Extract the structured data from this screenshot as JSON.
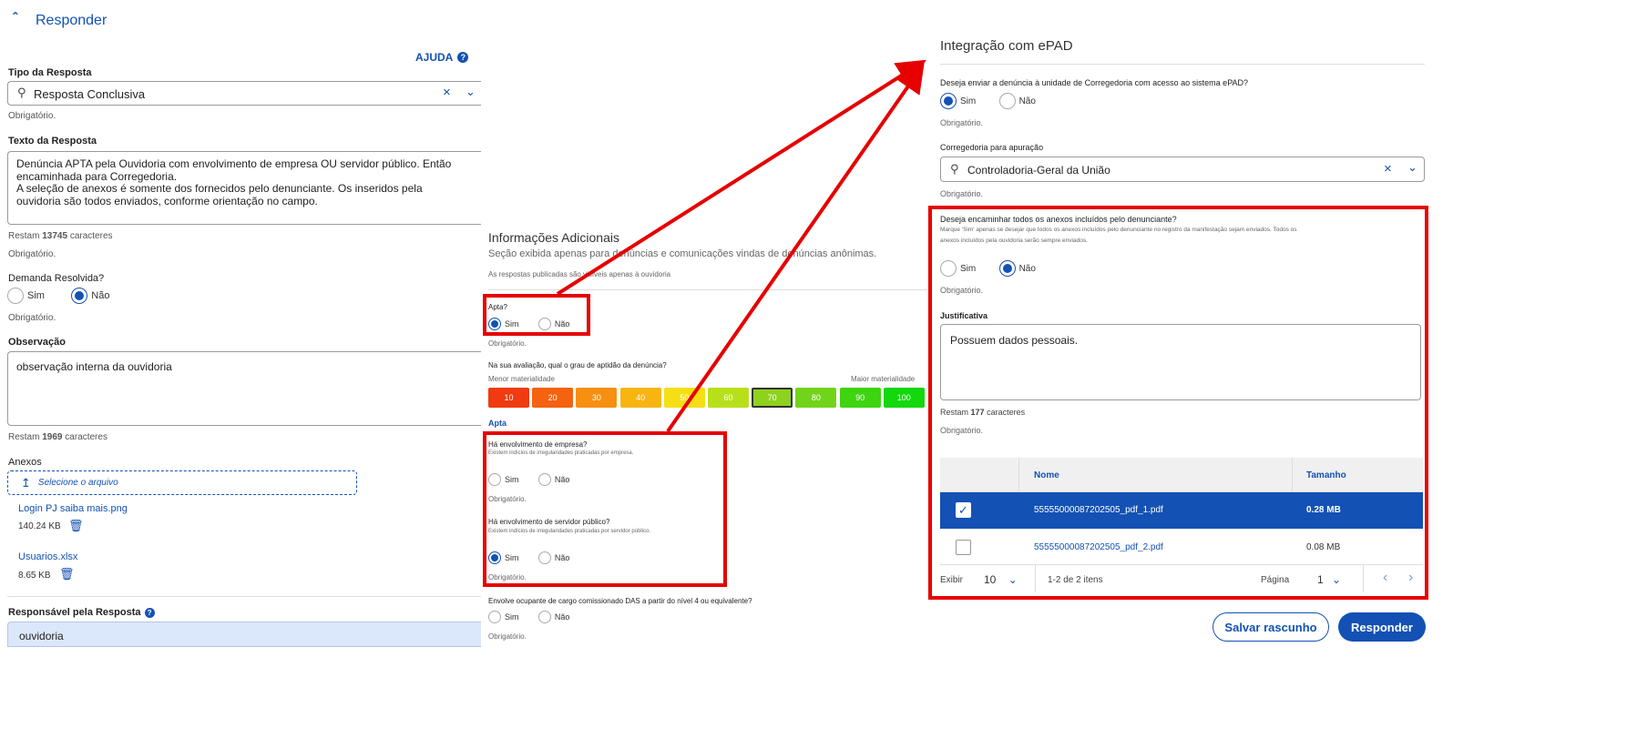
{
  "panel1": {
    "header": "Responder",
    "help": "AJUDA",
    "tipo_label": "Tipo da Resposta",
    "tipo_value": "Resposta Conclusiva",
    "required": "Obrigatório.",
    "texto_label": "Texto da Resposta",
    "texto_lines": [
      "Denúncia APTA pela Ouvidoria com envolvimento de empresa OU servidor público. Então",
      "encaminhada para Corregedoria.",
      "A seleção de anexos é somente dos fornecidos pelo denunciante. Os inseridos pela",
      "ouvidoria são todos enviados, conforme orientação no campo."
    ],
    "restam_pre": "Restam",
    "restam_suf": "caracteres",
    "texto_count": "13745",
    "demanda_label": "Demanda Resolvida?",
    "sim": "Sim",
    "nao": "Não",
    "obs_label": "Observação",
    "obs_value": "observação interna da ouvidoria",
    "obs_count": "1969",
    "anexos_label": "Anexos",
    "upload_label": "Selecione o arquivo",
    "files": [
      {
        "name": "Login PJ saiba mais.png",
        "size": "140.24 KB"
      },
      {
        "name": "Usuarios.xlsx",
        "size": "8.65 KB"
      }
    ],
    "responsavel_label": "Responsável pela Resposta",
    "responsavel_value": "ouvidoria"
  },
  "panel2": {
    "title": "Informações Adicionais",
    "subtitle": "Seção exibida apenas para denúncias e comunicações vindas de denúncias anônimas.",
    "note": "As respostas publicadas são visíveis apenas à ouvidoria",
    "apta_q": "Apta?",
    "aptidao_q": "Na sua avaliação, qual o grau de aptidão da denúncia?",
    "menor": "Menor materialidade",
    "maior": "Maior materialidade",
    "scale": [
      {
        "v": "10",
        "c": "#f03a10"
      },
      {
        "v": "20",
        "c": "#f56210"
      },
      {
        "v": "30",
        "c": "#f78f10"
      },
      {
        "v": "40",
        "c": "#f8b512"
      },
      {
        "v": "50",
        "c": "#f5df14"
      },
      {
        "v": "60",
        "c": "#b8e01a"
      },
      {
        "v": "70",
        "c": "#8ed21e"
      },
      {
        "v": "80",
        "c": "#72d41a"
      },
      {
        "v": "90",
        "c": "#3ed410"
      },
      {
        "v": "100",
        "c": "#12d80c"
      }
    ],
    "apta_tag": "Apta",
    "empresa_q": "Há envolvimento de empresa?",
    "empresa_hint": "Existem indícios de irregularidades praticadas por empresa.",
    "servidor_q": "Há envolvimento de servidor público?",
    "servidor_hint": "Existem indícios de irregularidades praticadas por servidor público.",
    "das_q": "Envolve ocupante de cargo comissionado DAS a partir do nível 4 ou equivalente?"
  },
  "panel3": {
    "title": "Integração com ePAD",
    "q1": "Deseja enviar a denúncia à unidade de Corregedoria com acesso ao sistema ePAD?",
    "corr_label": "Corregedoria para apuração",
    "corr_value": "Controladoria-Geral da União",
    "q2": "Deseja encaminhar todos os anexos incluídos pelo denunciante?",
    "q2_hint1": "Marque 'Sim' apenas se desejar que todos os anexos incluídos pelo denunciante no registro da manifestação sejam enviados. Todos os",
    "q2_hint2": "anexos incluídos pela ouvidoria serão sempre enviados.",
    "just_label": "Justificativa",
    "just_value": "Possuem dados pessoais.",
    "just_count": "177",
    "col_nome": "Nome",
    "col_tam": "Tamanho",
    "rows": [
      {
        "name": "55555000087202505_pdf_1.pdf",
        "size": "0.28 MB",
        "checked": true
      },
      {
        "name": "55555000087202505_pdf_2.pdf",
        "size": "0.08 MB",
        "checked": false
      }
    ],
    "exibir": "Exibir",
    "exibir_val": "10",
    "range": "1-2 de 2 itens",
    "pagina": "Página",
    "pagina_val": "1",
    "btn_draft": "Salvar rascunho",
    "btn_send": "Responder"
  }
}
